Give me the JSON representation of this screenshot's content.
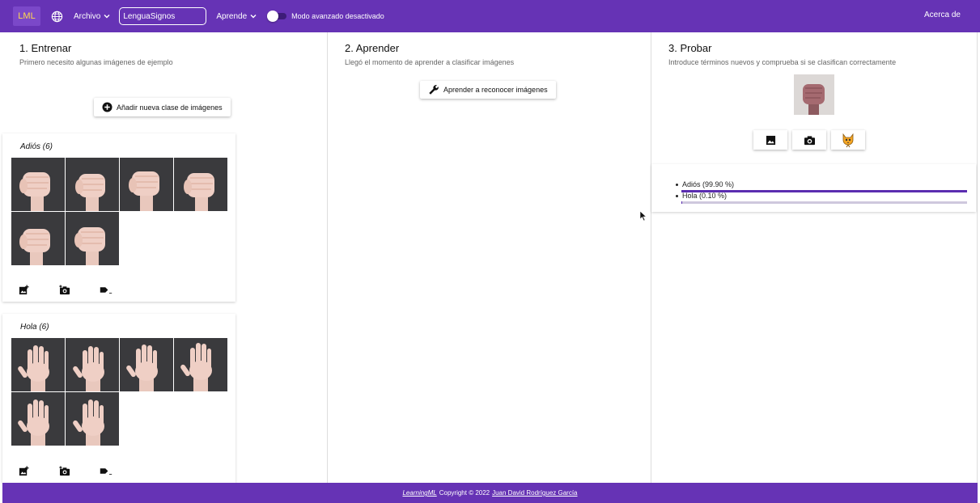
{
  "header": {
    "logo": "LML",
    "file_menu": "Archivo",
    "project_name": "LenguaSignos",
    "learn_menu": "Aprende",
    "advanced_mode_label": "Modo avanzado desactivado",
    "about": "Acerca de",
    "accent_color": "#6633b5"
  },
  "train": {
    "title": "1. Entrenar",
    "subtitle": "Primero necesito algunas imágenes de ejemplo",
    "add_class_label": "Añadir nueva clase de imágenes",
    "classes": [
      {
        "title": "Adiós (6)",
        "image_count": 6,
        "gesture": "fist"
      },
      {
        "title": "Hola (6)",
        "image_count": 6,
        "gesture": "open-hand"
      }
    ]
  },
  "learn": {
    "title": "2. Aprender",
    "subtitle": "Llegó el momento de aprender a clasificar imágenes",
    "button_label": "Aprender a reconocer imágenes"
  },
  "test": {
    "title": "3. Probar",
    "subtitle": "Introduce términos nuevos y comprueba si se clasifican correctamente",
    "results": [
      {
        "label": "Adiós (99.90 %)",
        "value": 0.999
      },
      {
        "label": "Hola (0.10 %)",
        "value": 0.001
      }
    ]
  },
  "footer": {
    "brand": "LearningML",
    "copyright": "Copyright © 2022",
    "author": "Juan David Rodríguez García"
  }
}
